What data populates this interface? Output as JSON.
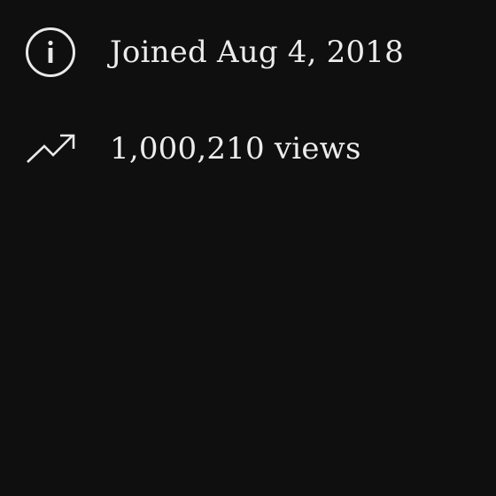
{
  "about": {
    "stats": [
      {
        "icon": "info-icon",
        "text": "Joined Aug 4, 2018"
      },
      {
        "icon": "trending-up-icon",
        "text": "1,000,210 views"
      }
    ]
  },
  "colors": {
    "background": "#0f0f0f",
    "text": "#ececec",
    "icon": "#e9e9e9"
  }
}
